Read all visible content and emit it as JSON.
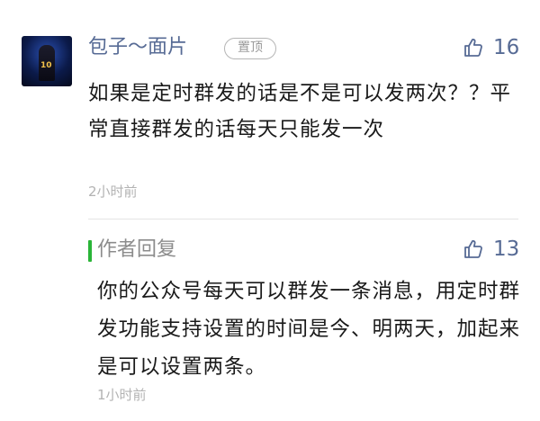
{
  "comment": {
    "author": "包子～面片",
    "badge": "置顶",
    "likes": "16",
    "text": "如果是定时群发的话是不是可以发两次？？平常直接群发的话每天只能发一次",
    "time": "2小时前"
  },
  "reply": {
    "title": "作者回复",
    "likes": "13",
    "text": "你的公众号每天可以群发一条消息，用定时群发功能支持设置的时间是今、明两天，加起来是可以设置两条。",
    "time": "1小时前"
  },
  "colors": {
    "name": "#576b95",
    "accent_bar": "#2ab538",
    "muted": "#b3b3b3",
    "text": "#1a1a1a"
  }
}
